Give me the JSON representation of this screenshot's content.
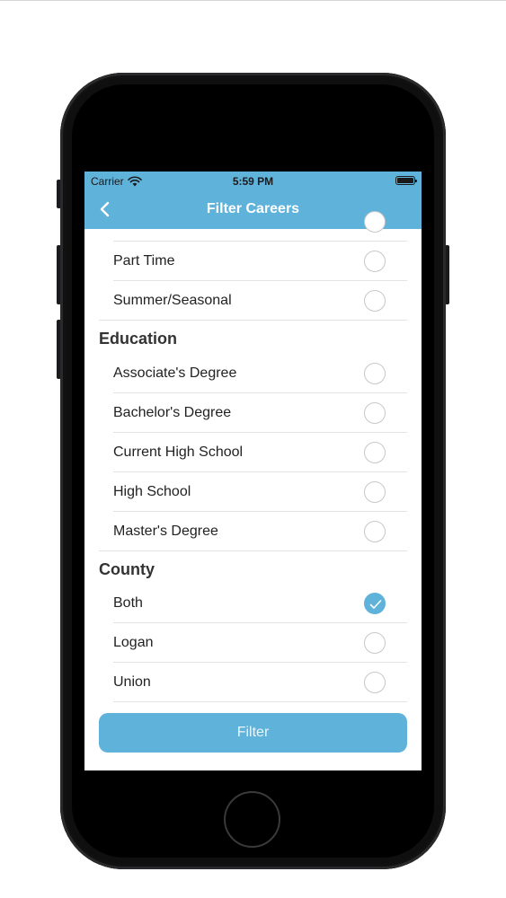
{
  "status_bar": {
    "carrier": "Carrier",
    "time": "5:59 PM"
  },
  "nav": {
    "title": "Filter Careers"
  },
  "sections": [
    {
      "title": "",
      "options": [
        {
          "label": "Part Time",
          "checked": false
        },
        {
          "label": "Summer/Seasonal",
          "checked": false
        }
      ]
    },
    {
      "title": "Education",
      "options": [
        {
          "label": "Associate's Degree",
          "checked": false
        },
        {
          "label": "Bachelor's Degree",
          "checked": false
        },
        {
          "label": "Current High School",
          "checked": false
        },
        {
          "label": "High School",
          "checked": false
        },
        {
          "label": "Master's Degree",
          "checked": false
        }
      ]
    },
    {
      "title": "County",
      "options": [
        {
          "label": "Both",
          "checked": true
        },
        {
          "label": "Logan",
          "checked": false
        },
        {
          "label": "Union",
          "checked": false
        }
      ]
    }
  ],
  "filter_button": {
    "label": "Filter"
  },
  "colors": {
    "accent": "#5fb2da"
  },
  "icons": {
    "back": "chevron-left-icon",
    "wifi": "wifi-icon",
    "battery": "battery-icon",
    "check": "checkmark-icon"
  }
}
